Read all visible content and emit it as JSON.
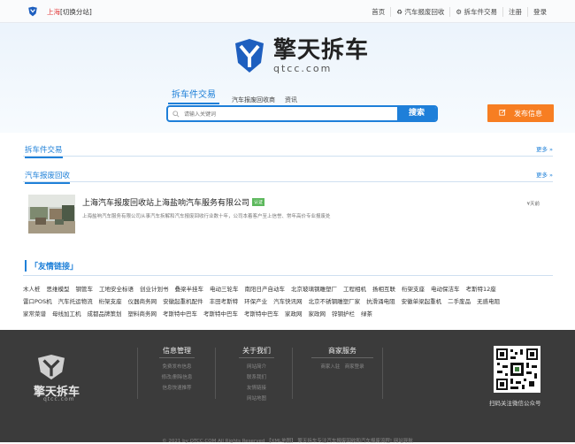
{
  "topbar": {
    "city": "上海",
    "switch_label": "[切换分站]",
    "nav": [
      "首页",
      "汽车报废回收",
      "拆车件交易",
      "注册",
      "登录"
    ]
  },
  "brand": {
    "name_cn": "擎天拆车",
    "name_en": "qtcc.com"
  },
  "search": {
    "tabs": [
      "拆车件交易",
      "汽车报废回收商",
      "资讯"
    ],
    "placeholder": "请输入关键词",
    "button_label": "搜索",
    "publish_label": "发布信息"
  },
  "sections": {
    "parts": {
      "title": "拆车件交易",
      "more": "更多 »"
    },
    "scrap": {
      "title": "汽车报废回收",
      "more": "更多 »"
    }
  },
  "listing": {
    "title": "上海汽车报废回收站上海盐响汽车服务有限公司",
    "badge": "认证",
    "desc": "上海盐响汽车服务有限公司从事汽车拆解和汽车报废回收行业数十年，公司本着客户至上信誉、常年高价专业报废处",
    "price": "¥天前"
  },
  "friends": {
    "title": "「友情链接」",
    "links": [
      "木人桩",
      "思维模型",
      "钢管车",
      "工地安全标语",
      "创业计划书",
      "叠梁半挂车",
      "电动三轮车",
      "南阳日产自动车",
      "北京玻璃钢雕塑厂",
      "工程相机",
      "扬相互联",
      "桁架支座",
      "电动保洁车",
      "考斯特12座",
      "雷口POS机",
      "汽车托运物流",
      "桁架支座",
      "仪器商务网",
      "安徽起重机配件",
      "丰田考斯特",
      "环保产业",
      "汽车快讯网",
      "北京不锈钢雕塑厂家",
      "抗滑涌电阻",
      "安徽单梁起重机",
      "二手废品",
      "无惑电阻",
      "家常菜谱",
      "母线加工机",
      "成都品牌策划",
      "塑料商务网",
      "考斯特中巴车",
      "考斯特中巴车",
      "考斯特中巴车",
      "家政网",
      "家政网",
      "锌钢护栏",
      "绿茶"
    ]
  },
  "footer": {
    "logo_cn": "擎天拆车",
    "logo_en": "qtcc.com",
    "columns": [
      {
        "title": "信息管理",
        "items": [
          "免费发布信息",
          "修改/删除信息",
          "信息快速推荐"
        ]
      },
      {
        "title": "关于我们",
        "items": [
          "网站简介",
          "联系我们",
          "友情链接",
          "网站地图"
        ]
      },
      {
        "title": "商家服务",
        "items": [
          "商家入驻",
          "商家登录"
        ]
      }
    ],
    "qr_label": "扫码关注微信公众号",
    "copyright": "© 2021 by QTCC.COM All Rights Reserved 【XML地图】 擎天拆车专注汽车报废回收和汽车报废流程! 网站导航"
  },
  "colors": {
    "accent": "#1f80d8",
    "orange": "#f77e22",
    "footer_bg": "#3b3b3b"
  }
}
